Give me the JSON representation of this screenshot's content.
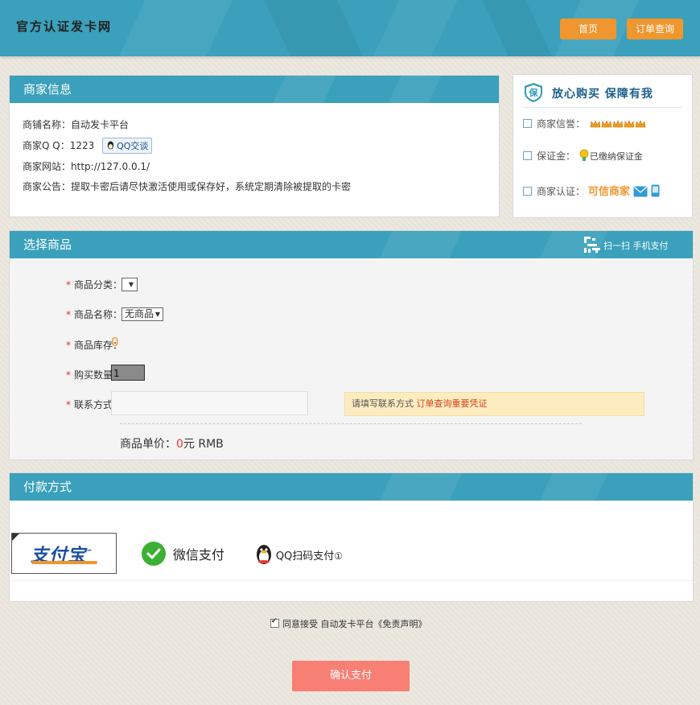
{
  "header": {
    "logo": "官方认证发卡网",
    "nav": [
      "首页",
      "订单查询"
    ]
  },
  "merchant": {
    "title": "商家信息",
    "rows": [
      {
        "label": "商铺名称：",
        "value": "自动发卡平台"
      },
      {
        "label": "商家Q Q：",
        "value": "1223"
      },
      {
        "label": "商家网站：",
        "value": "http://127.0.0.1/"
      },
      {
        "label": "商家公告：",
        "value": "提取卡密后请尽快激活使用或保存好，系统定期清除被提取的卡密"
      }
    ],
    "qq_button": "QQ交谈"
  },
  "guarantee": {
    "badge": "保",
    "title": "放心购买  保障有我",
    "rows": [
      {
        "label": "商家信誉：",
        "value": ""
      },
      {
        "label": "保证金：",
        "value": "已缴纳保证金"
      },
      {
        "label": "商家认证：",
        "value": "可信商家"
      }
    ]
  },
  "product": {
    "title": "选择商品",
    "scan_label": "扫一扫 手机支付",
    "fields": [
      {
        "label": "商品分类：",
        "value": ""
      },
      {
        "label": "商品名称：",
        "value": "无商品"
      },
      {
        "label": "商品库存：",
        "value": "0"
      },
      {
        "label": "购买数量：",
        "value": "1"
      },
      {
        "label": "联系方式：",
        "value": ""
      }
    ],
    "contact_hint": "请填写联系方式",
    "contact_hint_em": "订单查询重要凭证",
    "price_label": "商品单价：",
    "price_value": "0",
    "price_unit": "元 RMB"
  },
  "payment": {
    "title": "付款方式",
    "methods": [
      "支付宝",
      "微信支付",
      "QQ扫码支付"
    ],
    "qq_suffix": "①",
    "alipay_tm": "™"
  },
  "agree": {
    "text": "同意接受 自动发卡平台《免责声明》"
  },
  "confirm": {
    "label": "确认支付"
  },
  "colors": {
    "primary": "#3aa0bb",
    "orange": "#f0962e",
    "confirm": "#f87f74",
    "hint_bg": "#fdecc0",
    "hint_em": "#d5421b"
  }
}
